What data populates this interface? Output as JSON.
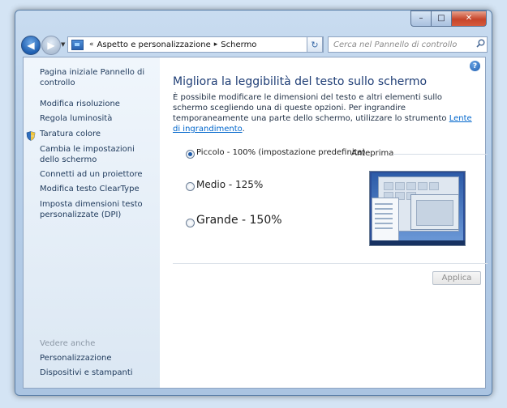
{
  "window": {
    "caption_buttons": {
      "minimize": "–",
      "maximize": "□",
      "close": "✕"
    }
  },
  "nav": {
    "back_glyph": "◀",
    "forward_glyph": "▶",
    "recent_glyph": "▼"
  },
  "addressbar": {
    "overflow_glyph": "«",
    "breadcrumbs": [
      "Aspetto e personalizzazione",
      "Schermo"
    ],
    "separator": "▸",
    "dropdown_glyph": "▼",
    "refresh_glyph": "↻"
  },
  "search": {
    "placeholder": "Cerca nel Pannello di controllo",
    "icon": "search-icon"
  },
  "sidebar": {
    "links": [
      "Pagina iniziale Pannello di controllo",
      "Modifica risoluzione",
      "Regola luminosità",
      "Taratura colore",
      "Cambia le impostazioni dello schermo",
      "Connetti ad un proiettore",
      "Modifica testo ClearType",
      "Imposta dimensioni testo personalizzate (DPI)"
    ],
    "see_also": "Vedere anche",
    "see_also_links": [
      "Personalizzazione",
      "Dispositivi e stampanti"
    ]
  },
  "main": {
    "help_glyph": "?",
    "title": "Migliora la leggibilità del testo sullo schermo",
    "intro_text": "È possibile modificare le dimensioni del testo e altri elementi sullo schermo scegliendo una di queste opzioni. Per ingrandire temporaneamente una parte dello schermo, utilizzare lo strumento ",
    "intro_link": "Lente di ingrandimento",
    "intro_end": ".",
    "options": [
      {
        "label": "Piccolo - 100% (impostazione predefinita)",
        "selected": true
      },
      {
        "label": "Medio - 125%",
        "selected": false
      },
      {
        "label": "Grande - 150%",
        "selected": false
      }
    ],
    "preview_label": "Anteprima",
    "apply_label": "Applica"
  },
  "colors": {
    "title": "#1e3d75",
    "link": "#0066cc",
    "accent": "#1e5aa8"
  }
}
